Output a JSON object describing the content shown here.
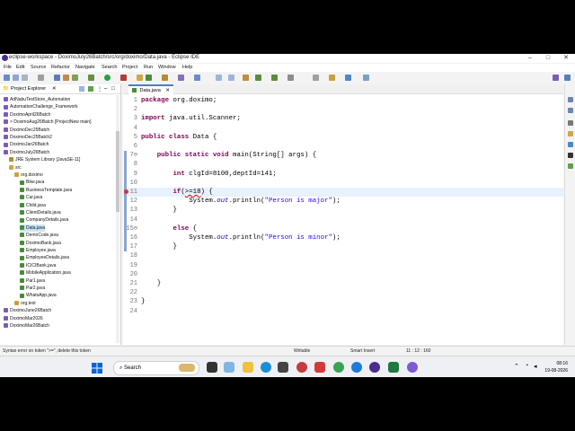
{
  "window": {
    "title": "eclipse-workspace - DoximoJuly26Batch/src/org/doximo/Data.java - Eclipse IDE",
    "controls": [
      "–",
      "□",
      "✕"
    ]
  },
  "menu": [
    "File",
    "Edit",
    "Source",
    "Refactor",
    "Navigate",
    "Search",
    "Project",
    "Run",
    "Window",
    "Help"
  ],
  "explorer": {
    "title": "Project Explorer",
    "items": [
      {
        "label": "AdNabuTestStore_Automation",
        "indent": 0,
        "type": "project"
      },
      {
        "label": "AutomationChallenge_Framework",
        "indent": 0,
        "type": "project"
      },
      {
        "label": "DoximoApril26Batch",
        "indent": 0,
        "type": "project"
      },
      {
        "label": "> DoximoAug26Batch [ProjectNew main]",
        "indent": 0,
        "type": "project"
      },
      {
        "label": "DoximoDec25Batch",
        "indent": 0,
        "type": "project"
      },
      {
        "label": "DoximoDec25Batch2",
        "indent": 0,
        "type": "project"
      },
      {
        "label": "DoximoJan26Batch",
        "indent": 0,
        "type": "project"
      },
      {
        "label": "DoximoJuly26Batch",
        "indent": 0,
        "type": "project"
      },
      {
        "label": "JRE System Library [JavaSE-11]",
        "indent": 1,
        "type": "lib"
      },
      {
        "label": "src",
        "indent": 1,
        "type": "folder"
      },
      {
        "label": "org.doximo",
        "indent": 2,
        "type": "package"
      },
      {
        "label": "Bike.java",
        "indent": 3,
        "type": "file"
      },
      {
        "label": "BusinessTemplate.java",
        "indent": 3,
        "type": "file"
      },
      {
        "label": "Car.java",
        "indent": 3,
        "type": "file"
      },
      {
        "label": "Child.java",
        "indent": 3,
        "type": "file"
      },
      {
        "label": "ClientDetails.java",
        "indent": 3,
        "type": "file"
      },
      {
        "label": "CompanyDetails.java",
        "indent": 3,
        "type": "file"
      },
      {
        "label": "Data.java",
        "indent": 3,
        "type": "file",
        "selected": true
      },
      {
        "label": "DemoCode.java",
        "indent": 3,
        "type": "file"
      },
      {
        "label": "DoximoBank.java",
        "indent": 3,
        "type": "file"
      },
      {
        "label": "Employee.java",
        "indent": 3,
        "type": "file"
      },
      {
        "label": "EmployeeDetails.java",
        "indent": 3,
        "type": "file"
      },
      {
        "label": "ICICIBank.java",
        "indent": 3,
        "type": "file"
      },
      {
        "label": "MobileApplication.java",
        "indent": 3,
        "type": "file"
      },
      {
        "label": "Par1.java",
        "indent": 3,
        "type": "file"
      },
      {
        "label": "Par2.java",
        "indent": 3,
        "type": "file"
      },
      {
        "label": "WhatsApp.java",
        "indent": 3,
        "type": "file"
      },
      {
        "label": "org.test",
        "indent": 2,
        "type": "package"
      },
      {
        "label": "DoximoJune26Batch",
        "indent": 0,
        "type": "project"
      },
      {
        "label": "DoximoMar2026",
        "indent": 0,
        "type": "project"
      },
      {
        "label": "DoximoMar26Batch",
        "indent": 0,
        "type": "project"
      }
    ]
  },
  "editor": {
    "tab_label": "Data.java",
    "tab_close": "✕",
    "lines": [
      {
        "n": "1",
        "html": "<span class=\"kw\">package</span> org.doximo;"
      },
      {
        "n": "2",
        "html": ""
      },
      {
        "n": "3",
        "html": "<span class=\"kw\">import</span> java.util.Scanner;"
      },
      {
        "n": "4",
        "html": ""
      },
      {
        "n": "5",
        "html": "<span class=\"kw\">public class</span> Data {"
      },
      {
        "n": "6",
        "html": ""
      },
      {
        "n": "7⊖",
        "html": "    <span class=\"kw\">public static void</span> main(String[] args) {"
      },
      {
        "n": "8",
        "html": ""
      },
      {
        "n": "9",
        "html": "        <span class=\"kw\">int</span> clgId=8100,deptId=141;"
      },
      {
        "n": "10",
        "html": ""
      },
      {
        "n": "11",
        "html": "        <span class=\"kw\">if</span>(<span class=\"err\">>=18</span>) {",
        "current": true
      },
      {
        "n": "12",
        "html": "            System.<span class=\"fld\">out</span>.println(<span class=\"str\">\"Person is major\"</span>);"
      },
      {
        "n": "13",
        "html": "        }"
      },
      {
        "n": "14",
        "html": ""
      },
      {
        "n": "15⊖",
        "html": "        <span class=\"kw\">else</span> {"
      },
      {
        "n": "16",
        "html": "            System.<span class=\"fld\">out</span>.println(<span class=\"str\">\"Person is minor\"</span>);"
      },
      {
        "n": "17",
        "html": "        }"
      },
      {
        "n": "18",
        "html": ""
      },
      {
        "n": "19",
        "html": ""
      },
      {
        "n": "20",
        "html": ""
      },
      {
        "n": "21",
        "html": "    }"
      },
      {
        "n": "22",
        "html": ""
      },
      {
        "n": "23",
        "html": "}"
      },
      {
        "n": "24",
        "html": ""
      }
    ]
  },
  "status": {
    "message": "Syntax error on token \">=\", delete this token",
    "writable": "Writable",
    "insert": "Smart Insert",
    "position": "11 : 12 : 160"
  },
  "taskbar": {
    "search_placeholder": "Search",
    "time": "08:16",
    "date": "19-08-2026"
  },
  "colors": {
    "keyword": "#7f0055",
    "string": "#2a00ff",
    "field": "#0000c0",
    "accent": "#4c7fbf"
  }
}
